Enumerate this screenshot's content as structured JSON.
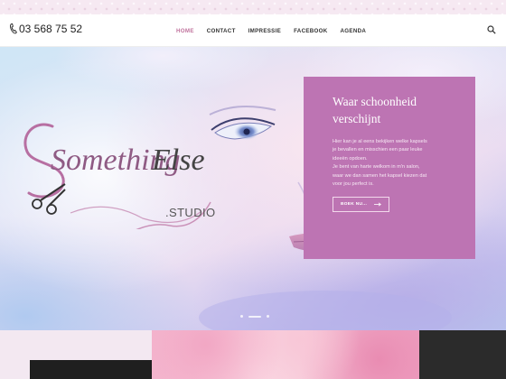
{
  "header": {
    "phone": "03 568 75 52",
    "nav": [
      {
        "label": "HOME",
        "active": true
      },
      {
        "label": "CONTACT",
        "active": false
      },
      {
        "label": "IMPRESSIE",
        "active": false
      },
      {
        "label": "FACEBOOK",
        "active": false
      },
      {
        "label": "AGENDA",
        "active": false
      }
    ],
    "icons": {
      "phone": "phone-icon",
      "search": "search-icon"
    },
    "accent_color": "#c1749e"
  },
  "hero": {
    "logo_text_1": "Something",
    "logo_text_2": "Else",
    "logo_icon": "scissors-icon",
    "studio": ".STUDIO",
    "slider_dots": 3,
    "active_dot": 1
  },
  "promo": {
    "title": "Waar schoonheid verschijnt",
    "text": "Hier kan je al eens bekijken welke kapsels je bevallen en misschien een paar leuke ideeën opdoen. Je bent van harte welkom in m'n salon, waar we dan samen het kapsel kiezen dat voor jou perfect is.",
    "text_line_1": "Hier kan je al eens bekijken welke kapsels",
    "text_line_2": "je bevallen en misschien een paar leuke",
    "text_line_3": "ideeën opdoen.",
    "text_line_4": "Je bent van harte welkom in m'n salon,",
    "text_line_5": "waar we dan samen het kapsel kiezen dat",
    "text_line_6": "voor jou perfect is.",
    "button_label": "BOEK NU...",
    "button_icon": "arrow-right-icon",
    "background_color": "#bd74b3"
  },
  "colors": {
    "promo_bg": "#bd74b3",
    "footer_dark": "#2b2b2b",
    "footer_pink": "#f3e8f1"
  }
}
